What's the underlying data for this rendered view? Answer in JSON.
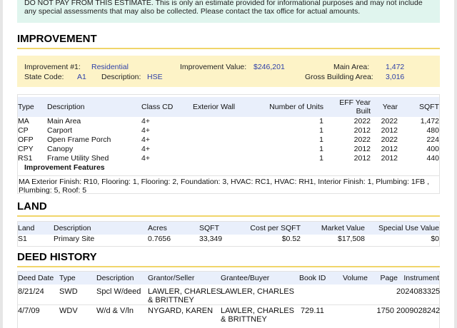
{
  "disclaimer": "DO NOT PAY FROM THIS ESTIMATE. This is only an estimate provided for informational purposes and may not include any special assessments that may also be collected. Please contact the tax office for actual amounts.",
  "improvement": {
    "heading": "IMPROVEMENT",
    "summary": {
      "improvement_label": "Improvement #1:",
      "improvement_value": "Residential",
      "state_code_label": "State Code:",
      "state_code_value": "A1",
      "description_label": "Description:",
      "description_value": "HSE",
      "value_label": "Improvement Value:",
      "value_amount": "$246,201",
      "main_area_label": "Main Area:",
      "main_area_value": "1,472",
      "gross_area_label": "Gross Building Area:",
      "gross_area_value": "3,016"
    },
    "columns": [
      "Type",
      "Description",
      "Class CD",
      "Exterior Wall",
      "Number of Units",
      "EFF Year Built",
      "Year",
      "SQFT"
    ],
    "rows": [
      [
        "MA",
        "Main Area",
        "4+",
        "",
        "1",
        "2022",
        "2022",
        "1,472"
      ],
      [
        "CP",
        "Carport",
        "4+",
        "",
        "1",
        "2012",
        "2012",
        "480"
      ],
      [
        "OFP",
        "Open Frame Porch",
        "4+",
        "",
        "1",
        "2022",
        "2022",
        "224"
      ],
      [
        "CPY",
        "Canopy",
        "4+",
        "",
        "1",
        "2012",
        "2012",
        "400"
      ],
      [
        "RS1",
        "Frame Utility Shed",
        "4+",
        "",
        "1",
        "2012",
        "2012",
        "440"
      ]
    ],
    "features_heading": "Improvement Features",
    "features_text": "MA Exterior Finish: R10, Flooring: 1, Flooring: 2, Foundation: 3, HVAC: RC1, HVAC: RH1, Interior Finish: 1, Plumbing: 1FB , Plumbing: 5, Roof: 5"
  },
  "land": {
    "heading": "LAND",
    "columns": [
      "Land",
      "Description",
      "Acres",
      "SQFT",
      "Cost per SQFT",
      "Market Value",
      "Special Use Value"
    ],
    "rows": [
      [
        "S1",
        "Primary Site",
        "0.7656",
        "33,349",
        "$0.52",
        "$17,508",
        "$0"
      ]
    ]
  },
  "deed_history": {
    "heading": "DEED HISTORY",
    "columns": [
      "Deed Date",
      "Type",
      "Description",
      "Grantor/Seller",
      "Grantee/Buyer",
      "Book ID",
      "Volume",
      "Page",
      "Instrument"
    ],
    "rows": [
      {
        "date": "8/21/24",
        "type": "SWD",
        "description": "Spcl W/deed",
        "grantor_line1": "LAWLER, CHARLES",
        "grantor_line2": "& BRITTNEY",
        "grantee": "LAWLER, CHARLES",
        "instrument": "2024083325"
      },
      {
        "date": "4/7/09",
        "type": "WDV",
        "description": "W/d & V/ln",
        "grantor_line1": "NYGARD, KAREN",
        "grantee_line1": "LAWLER, CHARLES",
        "grantee_line2": "& BRITTNEY",
        "book_id": "729.11",
        "page": "1750",
        "instrument": "2009028242"
      }
    ]
  }
}
